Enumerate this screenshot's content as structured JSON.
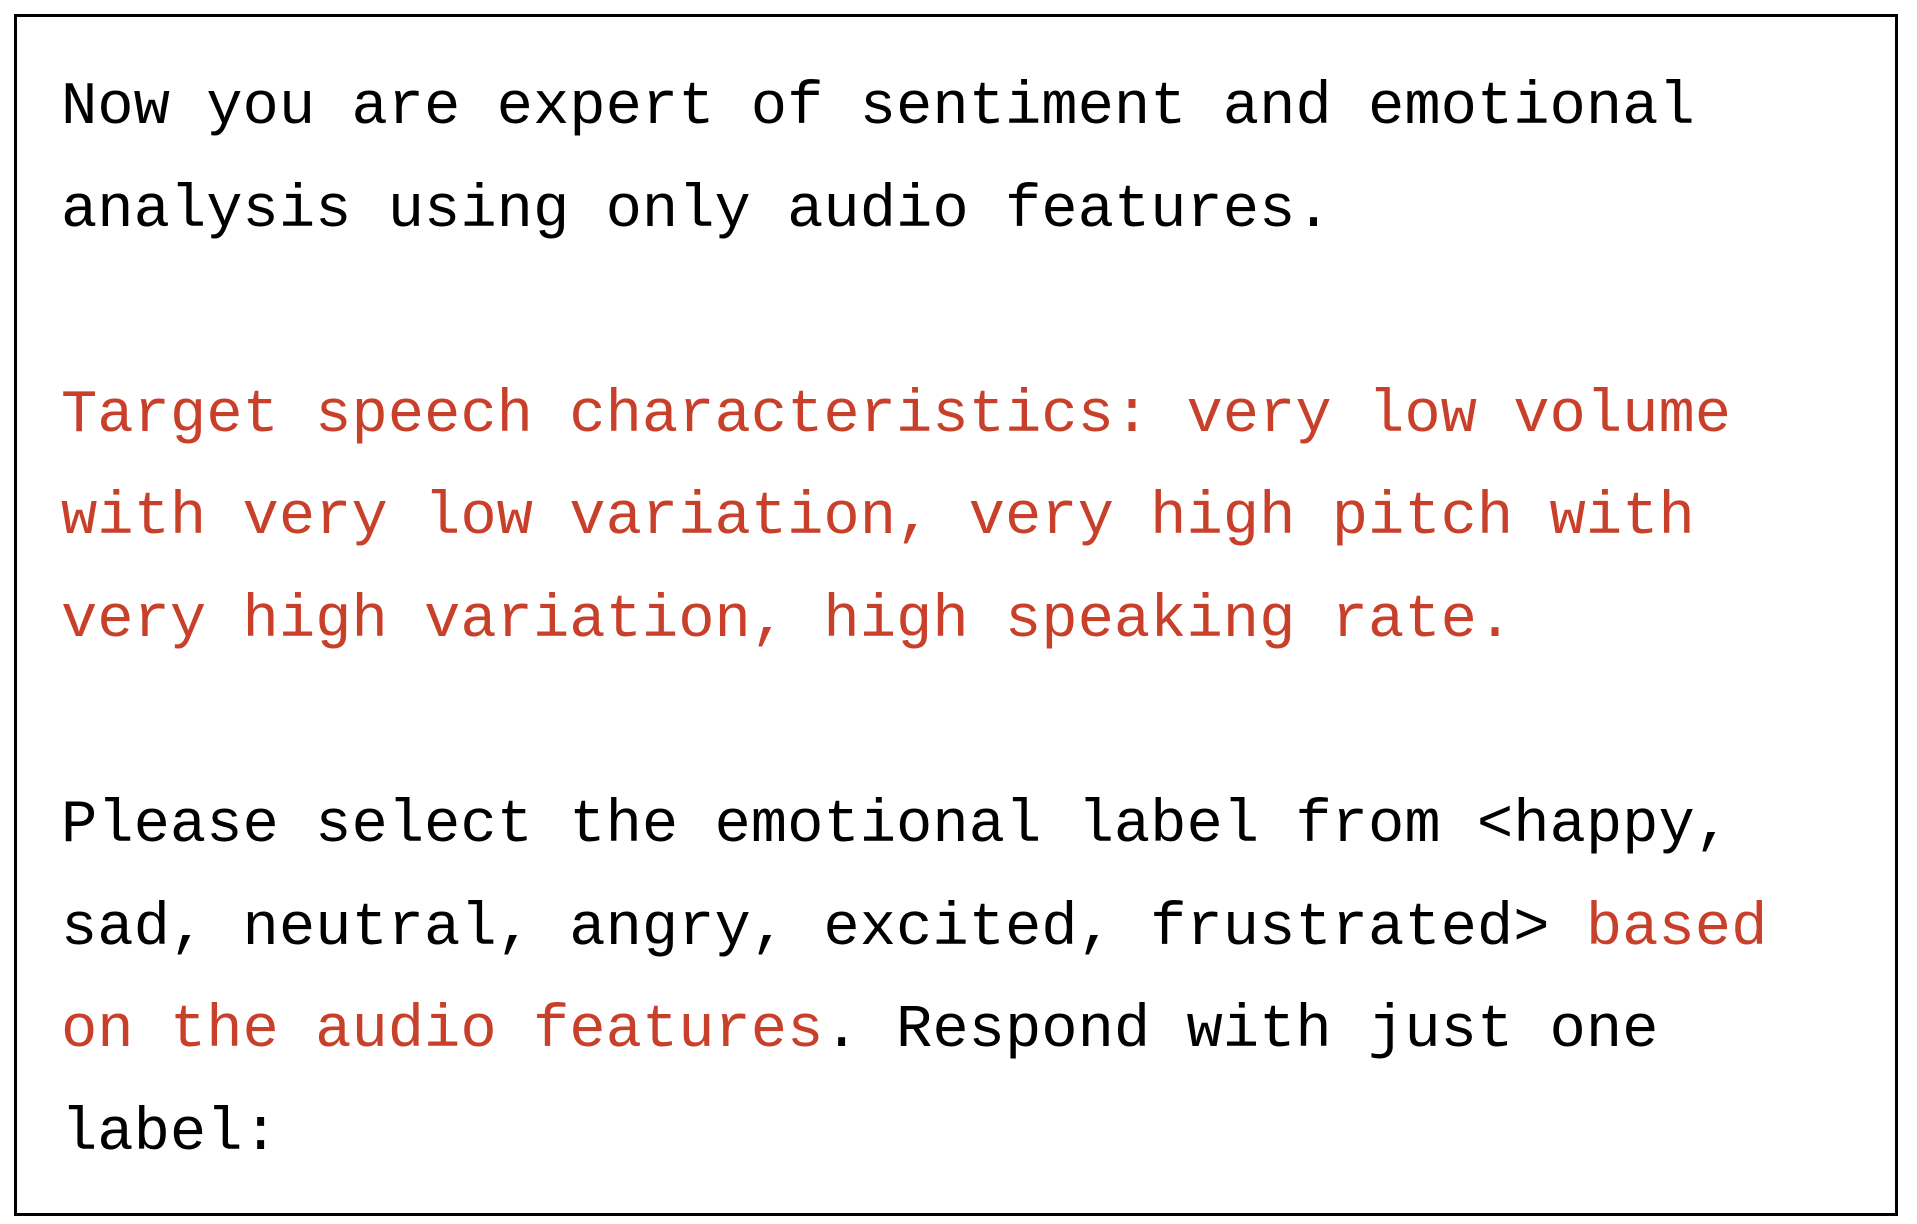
{
  "colors": {
    "text": "#000000",
    "highlight": "#c8402a",
    "border": "#000000",
    "background": "#ffffff"
  },
  "prompt": {
    "intro_line_1": "Now you are expert of sentiment and emotional",
    "intro_line_2": "analysis using only audio features.",
    "target_line_1": "Target speech characteristics: very low volume",
    "target_line_2": "with very low variation, very high pitch with",
    "target_line_3": "very high variation, high speaking rate.",
    "instr_line_1": "Please select the emotional label from <happy,",
    "instr_line_2_plain": "sad, neutral, angry, excited, frustrated> ",
    "instr_line_2_hl": "based",
    "instr_line_3_hl": "on the audio features",
    "instr_line_3_plain": ". Respond with just one",
    "instr_line_4": "label:"
  }
}
